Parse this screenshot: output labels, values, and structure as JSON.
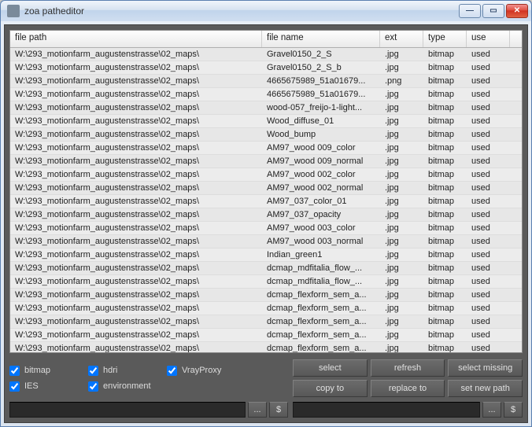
{
  "window": {
    "title": "zoa patheditor"
  },
  "columns": {
    "path": "file path",
    "name": "file name",
    "ext": "ext",
    "type": "type",
    "use": "use"
  },
  "rows": [
    {
      "path": "W:\\293_motionfarm_augustenstrasse\\02_maps\\",
      "name": "Gravel0150_2_S",
      "ext": ".jpg",
      "type": "bitmap",
      "use": "used"
    },
    {
      "path": "W:\\293_motionfarm_augustenstrasse\\02_maps\\",
      "name": "Gravel0150_2_S_b",
      "ext": ".jpg",
      "type": "bitmap",
      "use": "used"
    },
    {
      "path": "W:\\293_motionfarm_augustenstrasse\\02_maps\\",
      "name": "4665675989_51a01679...",
      "ext": ".png",
      "type": "bitmap",
      "use": "used"
    },
    {
      "path": "W:\\293_motionfarm_augustenstrasse\\02_maps\\",
      "name": "4665675989_51a01679...",
      "ext": ".jpg",
      "type": "bitmap",
      "use": "used"
    },
    {
      "path": "W:\\293_motionfarm_augustenstrasse\\02_maps\\",
      "name": "wood-057_freijo-1-light...",
      "ext": ".jpg",
      "type": "bitmap",
      "use": "used"
    },
    {
      "path": "W:\\293_motionfarm_augustenstrasse\\02_maps\\",
      "name": "Wood_diffuse_01",
      "ext": ".jpg",
      "type": "bitmap",
      "use": "used"
    },
    {
      "path": "W:\\293_motionfarm_augustenstrasse\\02_maps\\",
      "name": "Wood_bump",
      "ext": ".jpg",
      "type": "bitmap",
      "use": "used"
    },
    {
      "path": "W:\\293_motionfarm_augustenstrasse\\02_maps\\",
      "name": "AM97_wood 009_color",
      "ext": ".jpg",
      "type": "bitmap",
      "use": "used"
    },
    {
      "path": "W:\\293_motionfarm_augustenstrasse\\02_maps\\",
      "name": "AM97_wood 009_normal",
      "ext": ".jpg",
      "type": "bitmap",
      "use": "used"
    },
    {
      "path": "W:\\293_motionfarm_augustenstrasse\\02_maps\\",
      "name": "AM97_wood 002_color",
      "ext": ".jpg",
      "type": "bitmap",
      "use": "used"
    },
    {
      "path": "W:\\293_motionfarm_augustenstrasse\\02_maps\\",
      "name": "AM97_wood 002_normal",
      "ext": ".jpg",
      "type": "bitmap",
      "use": "used"
    },
    {
      "path": "W:\\293_motionfarm_augustenstrasse\\02_maps\\",
      "name": "AM97_037_color_01",
      "ext": ".jpg",
      "type": "bitmap",
      "use": "used"
    },
    {
      "path": "W:\\293_motionfarm_augustenstrasse\\02_maps\\",
      "name": "AM97_037_opacity",
      "ext": ".jpg",
      "type": "bitmap",
      "use": "used"
    },
    {
      "path": "W:\\293_motionfarm_augustenstrasse\\02_maps\\",
      "name": "AM97_wood 003_color",
      "ext": ".jpg",
      "type": "bitmap",
      "use": "used"
    },
    {
      "path": "W:\\293_motionfarm_augustenstrasse\\02_maps\\",
      "name": "AM97_wood 003_normal",
      "ext": ".jpg",
      "type": "bitmap",
      "use": "used"
    },
    {
      "path": "W:\\293_motionfarm_augustenstrasse\\02_maps\\",
      "name": "Indian_green1",
      "ext": ".jpg",
      "type": "bitmap",
      "use": "used"
    },
    {
      "path": "W:\\293_motionfarm_augustenstrasse\\02_maps\\",
      "name": "dcmap_mdfitalia_flow_...",
      "ext": ".jpg",
      "type": "bitmap",
      "use": "used"
    },
    {
      "path": "W:\\293_motionfarm_augustenstrasse\\02_maps\\",
      "name": "dcmap_mdfitalia_flow_...",
      "ext": ".jpg",
      "type": "bitmap",
      "use": "used"
    },
    {
      "path": "W:\\293_motionfarm_augustenstrasse\\02_maps\\",
      "name": "dcmap_flexform_sem_a...",
      "ext": ".jpg",
      "type": "bitmap",
      "use": "used"
    },
    {
      "path": "W:\\293_motionfarm_augustenstrasse\\02_maps\\",
      "name": "dcmap_flexform_sem_a...",
      "ext": ".jpg",
      "type": "bitmap",
      "use": "used"
    },
    {
      "path": "W:\\293_motionfarm_augustenstrasse\\02_maps\\",
      "name": "dcmap_flexform_sem_a...",
      "ext": ".jpg",
      "type": "bitmap",
      "use": "used"
    },
    {
      "path": "W:\\293_motionfarm_augustenstrasse\\02_maps\\",
      "name": "dcmap_flexform_sem_a...",
      "ext": ".jpg",
      "type": "bitmap",
      "use": "used"
    },
    {
      "path": "W:\\293_motionfarm_augustenstrasse\\02_maps\\",
      "name": "dcmap_flexform_sem_a...",
      "ext": ".jpg",
      "type": "bitmap",
      "use": "used"
    }
  ],
  "filters": {
    "bitmap": "bitmap",
    "hdri": "hdri",
    "vrayproxy": "VrayProxy",
    "ies": "IES",
    "environment": "environment"
  },
  "buttons": {
    "select": "select",
    "refresh": "refresh",
    "select_missing": "select missing",
    "copy_to": "copy to",
    "replace_to": "replace to",
    "set_new_path": "set new path",
    "browse": "...",
    "dollar": "$"
  },
  "inputs": {
    "path_left": "",
    "path_right": ""
  }
}
